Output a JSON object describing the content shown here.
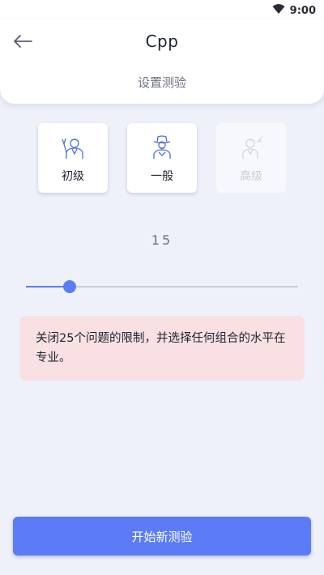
{
  "status_bar": {
    "time": "9:00",
    "icons": [
      "wifi-icon"
    ]
  },
  "header": {
    "title": "Cpp",
    "subtitle": "设置测验",
    "back_icon": "arrow-left-icon"
  },
  "levels": [
    {
      "label": "初级",
      "icon": "beginner-person-icon",
      "enabled": true
    },
    {
      "label": "一般",
      "icon": "cowboy-person-icon",
      "enabled": true
    },
    {
      "label": "高级",
      "icon": "expert-person-icon",
      "enabled": false
    }
  ],
  "question_count": {
    "value": "15",
    "slider_fraction": 0.16
  },
  "info": {
    "text": "关闭25个问题的限制，并选择任何组合的水平在专业。"
  },
  "start_button": {
    "label": "开始新测验"
  },
  "colors": {
    "accent": "#5b7cf6",
    "background": "#eef1fa",
    "info_background": "#f9e0e2"
  }
}
